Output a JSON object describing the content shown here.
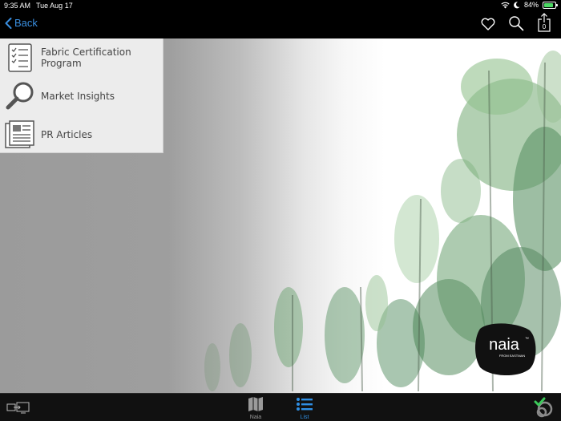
{
  "status_bar": {
    "time": "9:35 AM",
    "date": "Tue Aug 17",
    "battery_percent": "84%",
    "battery_level": 0.84,
    "icons": [
      "wifi-icon",
      "moon-icon",
      "battery-icon"
    ]
  },
  "nav": {
    "back_label": "Back",
    "actions": [
      "heart-icon",
      "search-icon",
      "share-icon"
    ],
    "share_badge": "0"
  },
  "menu": {
    "items": [
      {
        "label": "Fabric Certification Program",
        "icon": "checklist-icon"
      },
      {
        "label": "Market Insights",
        "icon": "magnifier-icon"
      },
      {
        "label": "PR Articles",
        "icon": "newspaper-icon"
      }
    ]
  },
  "logo": {
    "name": "naia",
    "tagline": "FROM EASTMAN",
    "trademark": "™"
  },
  "tab_bar": {
    "tabs": [
      {
        "label": "Naia",
        "icon": "map-icon",
        "active": false
      },
      {
        "label": "List",
        "icon": "list-icon",
        "active": true
      }
    ],
    "left_icon": "screen-mirror-icon",
    "right_icon": "sync-status-icon"
  },
  "colors": {
    "accent": "#3a8fe0",
    "tab_active": "#2f8fe5",
    "tab_inactive": "#9a9a9a",
    "menu_bg": "#ececec",
    "sync_check": "#3cc95a"
  }
}
